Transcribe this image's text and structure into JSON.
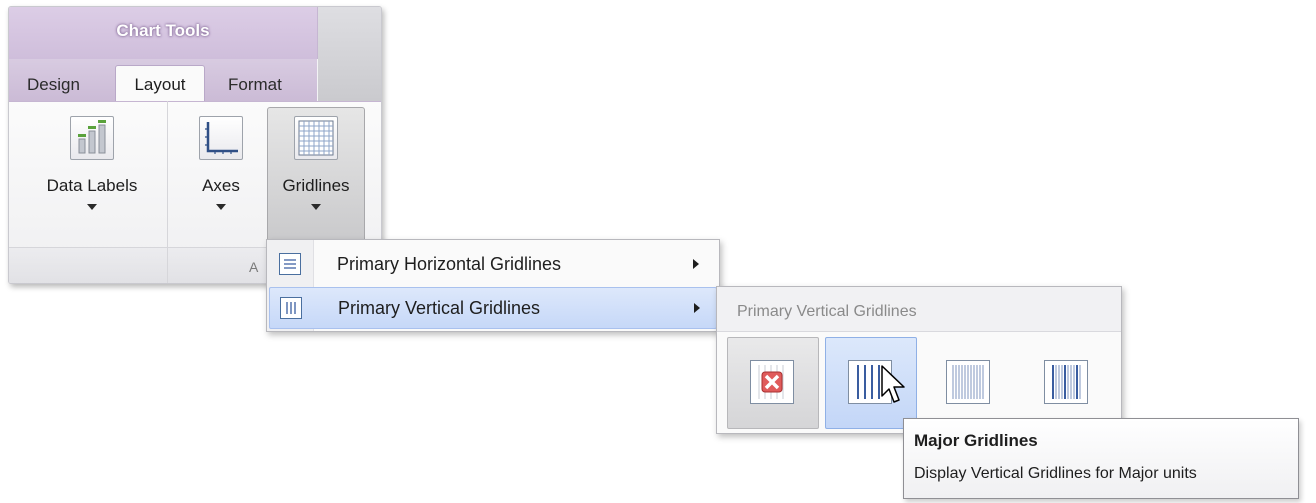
{
  "ribbon": {
    "context_title": "Chart Tools",
    "tabs": [
      {
        "label": "Design",
        "active": false
      },
      {
        "label": "Layout",
        "active": true
      },
      {
        "label": "Format",
        "active": false
      }
    ],
    "buttons": [
      {
        "label": "Data Labels",
        "icon": "data-labels-icon",
        "pressed": false
      },
      {
        "label": "Axes",
        "icon": "axes-icon",
        "pressed": false
      },
      {
        "label": "Gridlines",
        "icon": "gridlines-icon",
        "pressed": true
      }
    ],
    "group_caption_partial": "A"
  },
  "gridlines_menu": {
    "items": [
      {
        "label": "Primary Horizontal Gridlines",
        "icon": "horizontal-gridlines-icon",
        "highlighted": false
      },
      {
        "label": "Primary Vertical Gridlines",
        "icon": "vertical-gridlines-icon",
        "highlighted": true
      }
    ]
  },
  "vertical_gridlines_gallery": {
    "title": "Primary Vertical Gridlines",
    "options": [
      {
        "name": "none",
        "icon": "no-gridlines-icon"
      },
      {
        "name": "major",
        "icon": "major-gridlines-icon",
        "hover": true
      },
      {
        "name": "minor",
        "icon": "minor-gridlines-icon"
      },
      {
        "name": "major-and-minor",
        "icon": "major-minor-gridlines-icon"
      }
    ]
  },
  "tooltip": {
    "title": "Major Gridlines",
    "description": "Display Vertical Gridlines for Major units"
  },
  "colors": {
    "context_tab": "#d7c8e2",
    "menu_highlight": "#c6d8f8",
    "accent_blue": "#3a5da0"
  }
}
